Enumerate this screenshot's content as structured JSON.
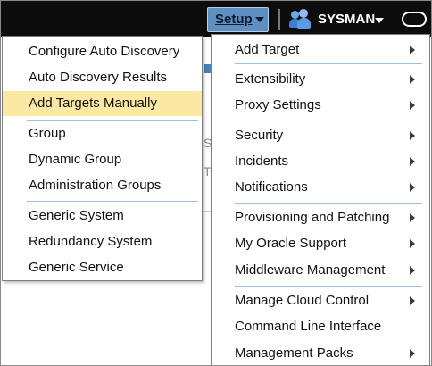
{
  "header": {
    "setup_label": "Setup",
    "user_label": "SYSMAN",
    "icons": [
      "chevron-down-icon",
      "users-icon",
      "oval-icon"
    ]
  },
  "background_fragments": [
    "S",
    "T",
    "|"
  ],
  "submenu": {
    "items": [
      {
        "label": "Configure Auto Discovery"
      },
      {
        "label": "Auto Discovery Results"
      },
      {
        "label": "Add Targets Manually",
        "highlighted": true
      },
      {
        "label": "Group"
      },
      {
        "label": "Dynamic Group"
      },
      {
        "label": "Administration Groups"
      },
      {
        "label": "Generic System"
      },
      {
        "label": "Redundancy System"
      },
      {
        "label": "Generic Service"
      }
    ]
  },
  "setup_menu": {
    "items": [
      {
        "label": "Add Target",
        "submenu": true
      },
      {
        "label": "Extensibility",
        "submenu": true
      },
      {
        "label": "Proxy Settings",
        "submenu": true
      },
      {
        "label": "Security",
        "submenu": true
      },
      {
        "label": "Incidents",
        "submenu": true
      },
      {
        "label": "Notifications",
        "submenu": true
      },
      {
        "label": "Provisioning and Patching",
        "submenu": true
      },
      {
        "label": "My Oracle Support",
        "submenu": true
      },
      {
        "label": "Middleware Management",
        "submenu": true
      },
      {
        "label": "Manage Cloud Control",
        "submenu": true
      },
      {
        "label": "Command Line Interface",
        "submenu": false
      },
      {
        "label": "Management Packs",
        "submenu": true
      }
    ]
  },
  "colors": {
    "header_bg": "#0c0c0c",
    "setup_button_bg": "#5f8fc0",
    "highlight_bg": "#fbe9a3",
    "divider": "#9cc0de"
  }
}
